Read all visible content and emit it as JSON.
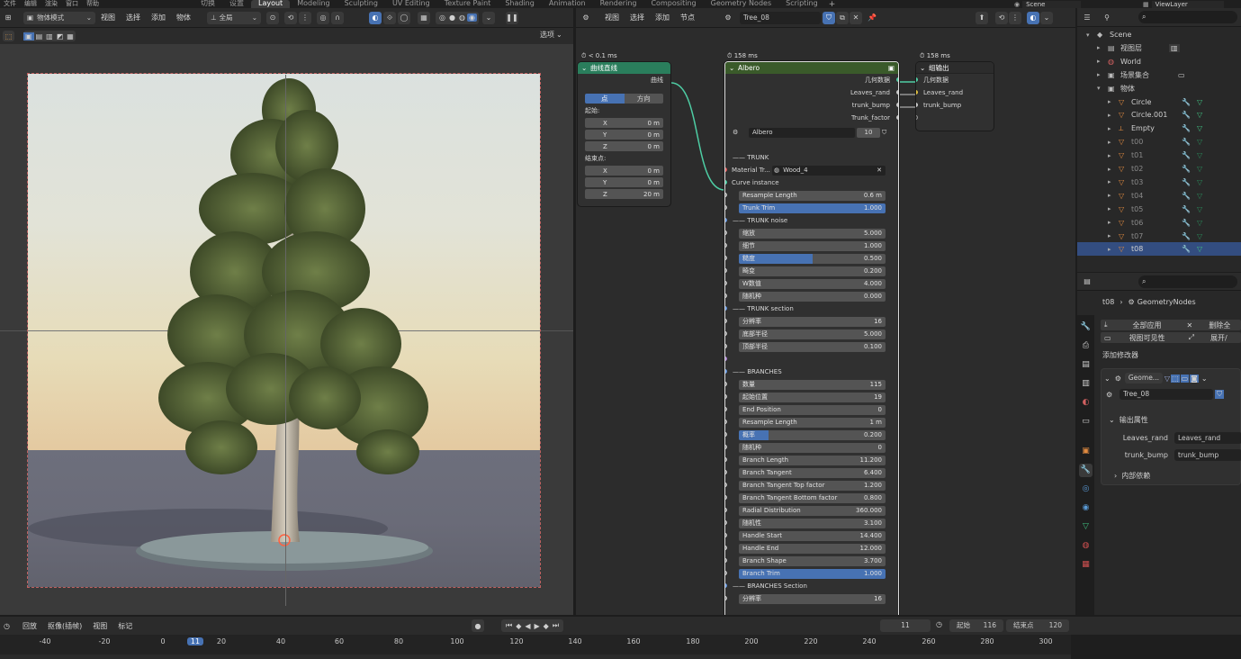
{
  "topbar": {
    "menus": [
      "文件",
      "编辑",
      "渲染",
      "窗口",
      "帮助"
    ],
    "workspaces": [
      "切换",
      "设置",
      "Layout",
      "Modeling",
      "Sculpting",
      "UV Editing",
      "Texture Paint",
      "Shading",
      "Animation",
      "Rendering",
      "Compositing",
      "Geometry Nodes",
      "Scripting"
    ],
    "active_workspace": "Layout",
    "add_tab": "+",
    "scene": "Scene",
    "view_layer": "ViewLayer"
  },
  "viewport": {
    "mode": "物体模式",
    "menus": [
      "视图",
      "选择",
      "添加",
      "物体"
    ],
    "transform": "全局",
    "options": "选项"
  },
  "node_editor": {
    "menus": [
      "视图",
      "选择",
      "添加",
      "节点"
    ],
    "tree_name": "Tree_08",
    "curve_node": {
      "timer": "< 0.1 ms",
      "title": "曲线直线",
      "output": "曲线",
      "mode_buttons": [
        "点",
        "方向"
      ],
      "start_label": "起始:",
      "end_label": "结束点:",
      "start": [
        {
          "axis": "X",
          "value": "0 m"
        },
        {
          "axis": "Y",
          "value": "0 m"
        },
        {
          "axis": "Z",
          "value": "0 m"
        }
      ],
      "end": [
        {
          "axis": "X",
          "value": "0 m"
        },
        {
          "axis": "Y",
          "value": "0 m"
        },
        {
          "axis": "Z",
          "value": "20 m"
        }
      ]
    },
    "albero_node": {
      "timer": "158 ms",
      "title": "Albero",
      "outputs": [
        "几何数据",
        "Leaves_rand",
        "trunk_bump",
        "Trunk_factor"
      ],
      "group_name": "Albero",
      "users": "10",
      "trunk_header": "TRUNK",
      "material_label": "Material Tr...",
      "material_value": "Wood_4",
      "curve_instance": "Curve instance",
      "rows": [
        {
          "label": "Resample Length",
          "value": "0.6 m"
        },
        {
          "label": "Trunk Trim",
          "value": "1.000",
          "fill": 1
        },
        {
          "section": "TRUNK noise"
        },
        {
          "label": "缩放",
          "value": "5.000"
        },
        {
          "label": "细节",
          "value": "1.000"
        },
        {
          "label": "糙度",
          "value": "0.500",
          "fill": 0.5
        },
        {
          "label": "畸变",
          "value": "0.200"
        },
        {
          "label": "W数值",
          "value": "4.000"
        },
        {
          "label": "随机种",
          "value": "0.000"
        },
        {
          "section": "TRUNK section"
        },
        {
          "label": "分辨率",
          "value": "16"
        },
        {
          "label": "底部半径",
          "value": "5.000"
        },
        {
          "label": "顶部半径",
          "value": "0.100"
        },
        {
          "gap": true
        },
        {
          "section": "BRANCHES"
        },
        {
          "label": "数量",
          "value": "115"
        },
        {
          "label": "起始位置",
          "value": "19"
        },
        {
          "label": "End Position",
          "value": "0"
        },
        {
          "label": "Resample Length",
          "value": "1 m"
        },
        {
          "label": "概率",
          "value": "0.200",
          "fill": 0.2
        },
        {
          "label": "随机种",
          "value": "0"
        },
        {
          "label": "Branch Length",
          "value": "11.200"
        },
        {
          "label": "Branch Tangent",
          "value": "6.400"
        },
        {
          "label": "Branch Tangent Top factor",
          "value": "1.200"
        },
        {
          "label": "Branch Tangent Bottom factor",
          "value": "0.800"
        },
        {
          "label": "Radial Distribution",
          "value": "360.000"
        },
        {
          "label": "随机性",
          "value": "3.100"
        },
        {
          "label": "Handle Start",
          "value": "14.400"
        },
        {
          "label": "Handle End",
          "value": "12.000"
        },
        {
          "label": "Branch Shape",
          "value": "3.700"
        },
        {
          "label": "Branch Trim",
          "value": "1.000",
          "fill": 1
        },
        {
          "section": "BRANCHES Section"
        },
        {
          "label": "分辨率",
          "value": "16"
        }
      ]
    },
    "output_node": {
      "timer": "158 ms",
      "title": "组输出",
      "inputs": [
        "几何数据",
        "Leaves_rand",
        "trunk_bump"
      ]
    }
  },
  "outliner": {
    "items": [
      {
        "name": "Scene",
        "indent": 0,
        "icon": "scene-icon"
      },
      {
        "name": "视图层",
        "indent": 1,
        "icon": "viewlayer-icon"
      },
      {
        "name": "World",
        "indent": 1,
        "icon": "world-icon"
      },
      {
        "name": "场景集合",
        "indent": 1,
        "icon": "collection-icon"
      },
      {
        "name": "物体",
        "indent": 1,
        "icon": "collection-icon"
      },
      {
        "name": "Circle",
        "indent": 2,
        "icon": "mesh-icon"
      },
      {
        "name": "Circle.001",
        "indent": 2,
        "icon": "mesh-icon"
      },
      {
        "name": "Empty",
        "indent": 2,
        "icon": "empty-icon"
      },
      {
        "name": "t00",
        "indent": 2,
        "icon": "mesh-icon",
        "dim": true
      },
      {
        "name": "t01",
        "indent": 2,
        "icon": "mesh-icon",
        "dim": true
      },
      {
        "name": "t02",
        "indent": 2,
        "icon": "mesh-icon",
        "dim": true
      },
      {
        "name": "t03",
        "indent": 2,
        "icon": "mesh-icon",
        "dim": true
      },
      {
        "name": "t04",
        "indent": 2,
        "icon": "mesh-icon",
        "dim": true
      },
      {
        "name": "t05",
        "indent": 2,
        "icon": "mesh-icon",
        "dim": true
      },
      {
        "name": "t06",
        "indent": 2,
        "icon": "mesh-icon",
        "dim": true
      },
      {
        "name": "t07",
        "indent": 2,
        "icon": "mesh-icon",
        "dim": true
      },
      {
        "name": "t08",
        "indent": 2,
        "icon": "mesh-icon",
        "selected": true
      }
    ]
  },
  "properties": {
    "breadcrumb_obj": "t08",
    "breadcrumb_mod": "GeometryNodes",
    "apply_all": "全部应用",
    "delete_all": "删除全",
    "viewport_vis": "视图可见性",
    "expand": "展开/",
    "add_modifier": "添加修改器",
    "modifier_name": "Geome...",
    "node_group": "Tree_08",
    "output_attrs": "输出属性",
    "attrs": [
      {
        "label": "Leaves_rand",
        "value": "Leaves_rand"
      },
      {
        "label": "trunk_bump",
        "value": "trunk_bump"
      }
    ],
    "internal_deps": "内部依赖"
  },
  "timeline": {
    "menus": [
      "回放",
      "抠像(插帧)",
      "视图",
      "标记"
    ],
    "current_frame": "11",
    "start_label": "起始",
    "start": "116",
    "end_label": "结束点",
    "end": "120",
    "ticks": [
      "-40",
      "-20",
      "0",
      "11",
      "20",
      "40",
      "60",
      "80",
      "100",
      "120",
      "140",
      "160",
      "180",
      "200",
      "220",
      "240",
      "260",
      "280",
      "300"
    ]
  }
}
